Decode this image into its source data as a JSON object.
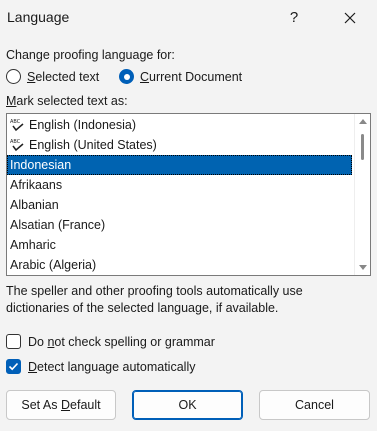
{
  "window": {
    "title": "Language",
    "help_label": "?"
  },
  "proofing": {
    "label": "Change proofing language for:",
    "options": [
      {
        "label_key": "S",
        "label_rest": "elected text",
        "checked": false
      },
      {
        "label_key": "C",
        "label_rest": "urrent Document",
        "checked": true
      }
    ]
  },
  "mark": {
    "label_key": "M",
    "label_rest": "ark selected text as:"
  },
  "languages": [
    {
      "name": "English (Indonesia)",
      "icon": "spellcheck-icon",
      "selected": false
    },
    {
      "name": "English (United States)",
      "icon": "spellcheck-icon",
      "selected": false
    },
    {
      "name": "Indonesian",
      "icon": null,
      "selected": true
    },
    {
      "name": "Afrikaans",
      "icon": null,
      "selected": false
    },
    {
      "name": "Albanian",
      "icon": null,
      "selected": false
    },
    {
      "name": "Alsatian (France)",
      "icon": null,
      "selected": false
    },
    {
      "name": "Amharic",
      "icon": null,
      "selected": false
    },
    {
      "name": "Arabic (Algeria)",
      "icon": null,
      "selected": false
    }
  ],
  "description": "The speller and other proofing tools automatically use dictionaries of the selected language, if available.",
  "checkboxes": [
    {
      "pre": "Do ",
      "key": "n",
      "post": "ot check spelling or grammar",
      "checked": false
    },
    {
      "pre": "",
      "key": "D",
      "post": "etect language automatically",
      "checked": true
    }
  ],
  "buttons": {
    "default_pre": "Set As ",
    "default_key": "D",
    "default_post": "efault",
    "ok": "OK",
    "cancel": "Cancel"
  },
  "colors": {
    "accent": "#005fb8",
    "selection": "#0063b1"
  }
}
